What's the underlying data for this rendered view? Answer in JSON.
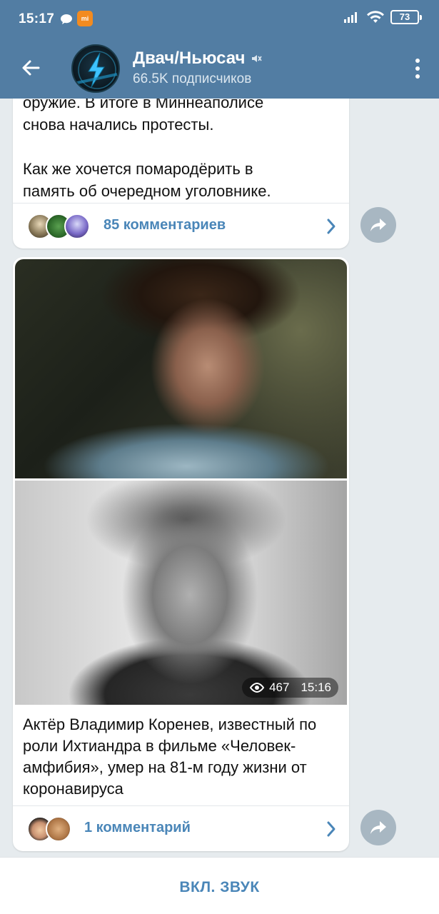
{
  "status_bar": {
    "time": "15:17",
    "battery": "73",
    "icons": [
      "chat-bubble-icon",
      "mi-app-icon",
      "signal-icon",
      "wifi-icon",
      "battery-icon"
    ]
  },
  "header": {
    "title": "Двач/Ньюсач",
    "subtitle": "66.5K подписчиков",
    "icons": [
      "back-arrow-icon",
      "muted-icon",
      "more-vert-icon"
    ],
    "color": "#527da3"
  },
  "posts": [
    {
      "text": "оружие. В итоге в Миннеаполисе\nснова начались протесты.\n\nКак же хочется помародёрить в\nпамять об очередном уголовнике.",
      "comments_label": "85 комментариев"
    },
    {
      "views": "467",
      "time": "15:16",
      "text": "Актёр Владимир Коренев, известный по роли Ихтиандра в фильме «Человек-амфибия», умер на 81-м году жизни от коронавируса",
      "comments_label": "1 комментарий"
    }
  ],
  "bottom_bar": {
    "label": "ВКЛ. ЗВУК"
  },
  "accent_color": "#4a86b8"
}
